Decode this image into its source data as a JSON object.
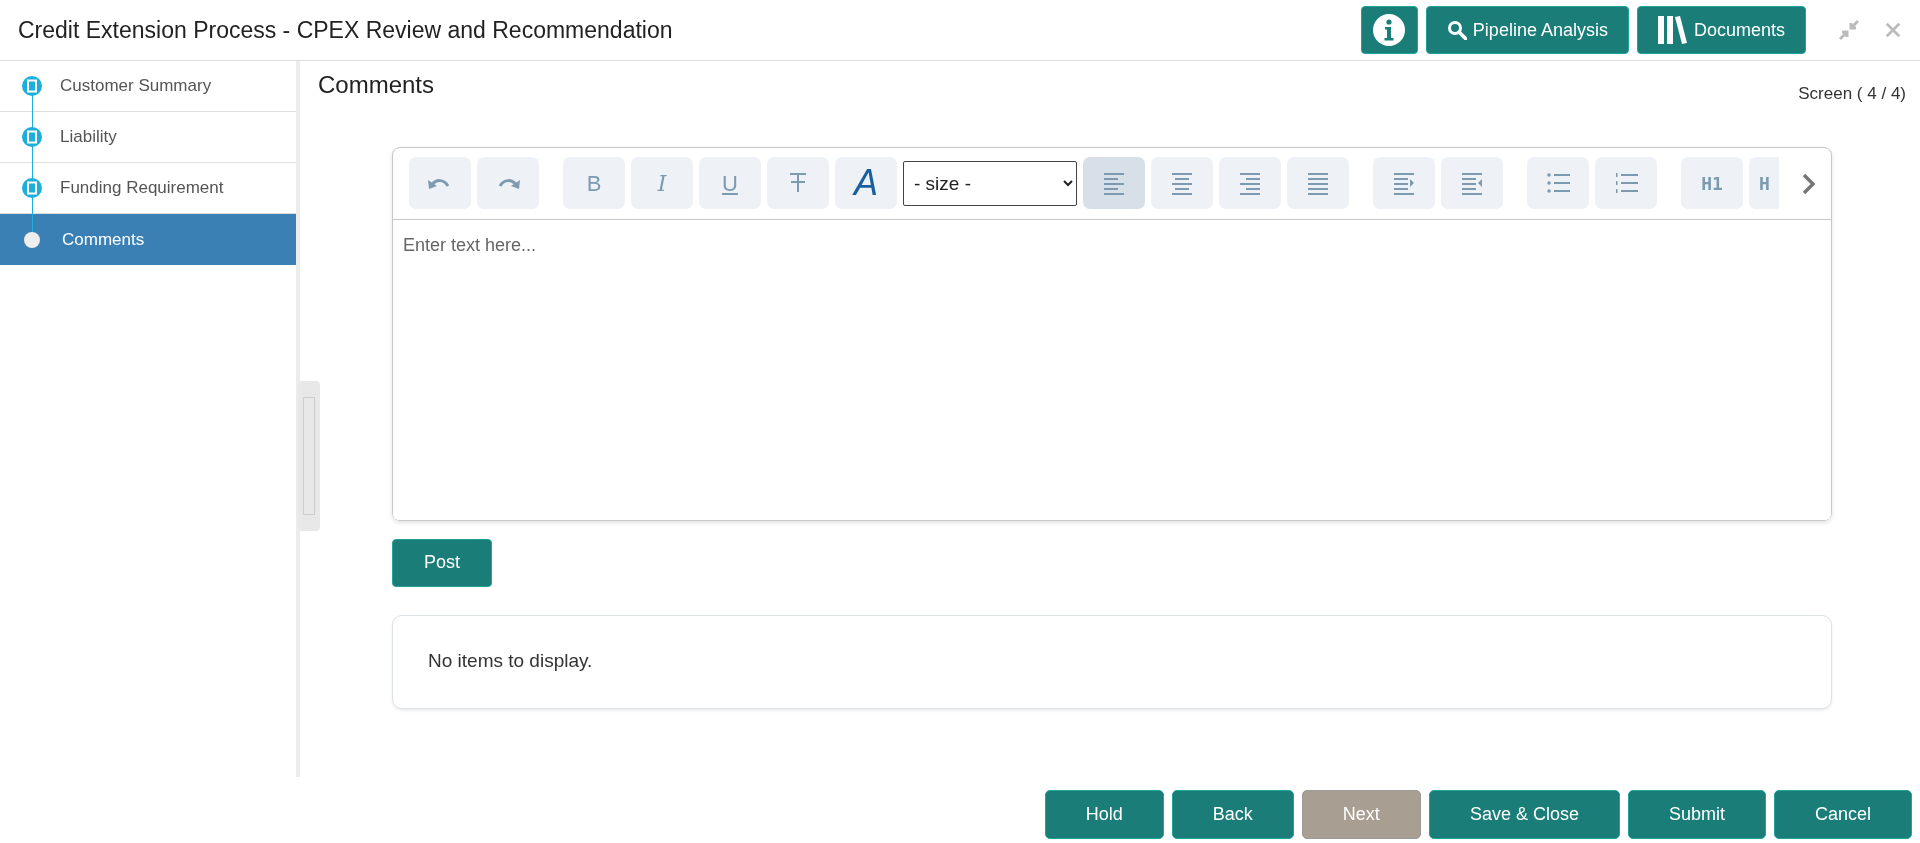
{
  "window": {
    "title": "Credit Extension Process - CPEX Review and Recommendation"
  },
  "header_buttons": [
    {
      "kind": "info"
    },
    {
      "kind": "search",
      "label": "Pipeline Analysis"
    },
    {
      "kind": "books",
      "label": "Documents"
    }
  ],
  "sidebar": {
    "items": [
      {
        "label": "Customer Summary",
        "completed": true,
        "selected": false
      },
      {
        "label": "Liability",
        "completed": true,
        "selected": false
      },
      {
        "label": "Funding Requirement",
        "completed": true,
        "selected": false
      },
      {
        "label": "Comments",
        "completed": false,
        "selected": true
      }
    ]
  },
  "page": {
    "title": "Comments",
    "screen_counter": "Screen ( 4 / 4)"
  },
  "editor": {
    "toolbar": [
      {
        "kind": "undo",
        "selected": false
      },
      {
        "kind": "redo",
        "selected": false
      },
      {
        "kind": "gap"
      },
      {
        "kind": "bold",
        "label": "B",
        "selected": false
      },
      {
        "kind": "italic",
        "label": "I",
        "selected": false
      },
      {
        "kind": "underline",
        "label": "U",
        "selected": false
      },
      {
        "kind": "strike",
        "selected": false
      },
      {
        "kind": "color",
        "label": "A",
        "selected": false
      },
      {
        "kind": "select",
        "value": "- size -"
      },
      {
        "kind": "align-left",
        "selected": true
      },
      {
        "kind": "align-center",
        "selected": false
      },
      {
        "kind": "align-right",
        "selected": false
      },
      {
        "kind": "justify",
        "selected": false
      },
      {
        "kind": "gap"
      },
      {
        "kind": "indent",
        "selected": false
      },
      {
        "kind": "outdent",
        "selected": false
      },
      {
        "kind": "gap"
      },
      {
        "kind": "bullets",
        "selected": false
      },
      {
        "kind": "numbers",
        "selected": false
      },
      {
        "kind": "gap"
      },
      {
        "kind": "heading",
        "label": "H1",
        "selected": false
      },
      {
        "kind": "heading",
        "label": "H",
        "selected": false
      }
    ],
    "placeholder": "Enter text here..."
  },
  "post_button": "Post",
  "comments_list": {
    "empty_text": "No items to display."
  },
  "footer_buttons": [
    {
      "label": "Hold",
      "disabled": false
    },
    {
      "label": "Back",
      "disabled": false
    },
    {
      "label": "Next",
      "disabled": true
    },
    {
      "label": "Save & Close",
      "disabled": false
    },
    {
      "label": "Submit",
      "disabled": false
    },
    {
      "label": "Cancel",
      "disabled": false
    }
  ]
}
